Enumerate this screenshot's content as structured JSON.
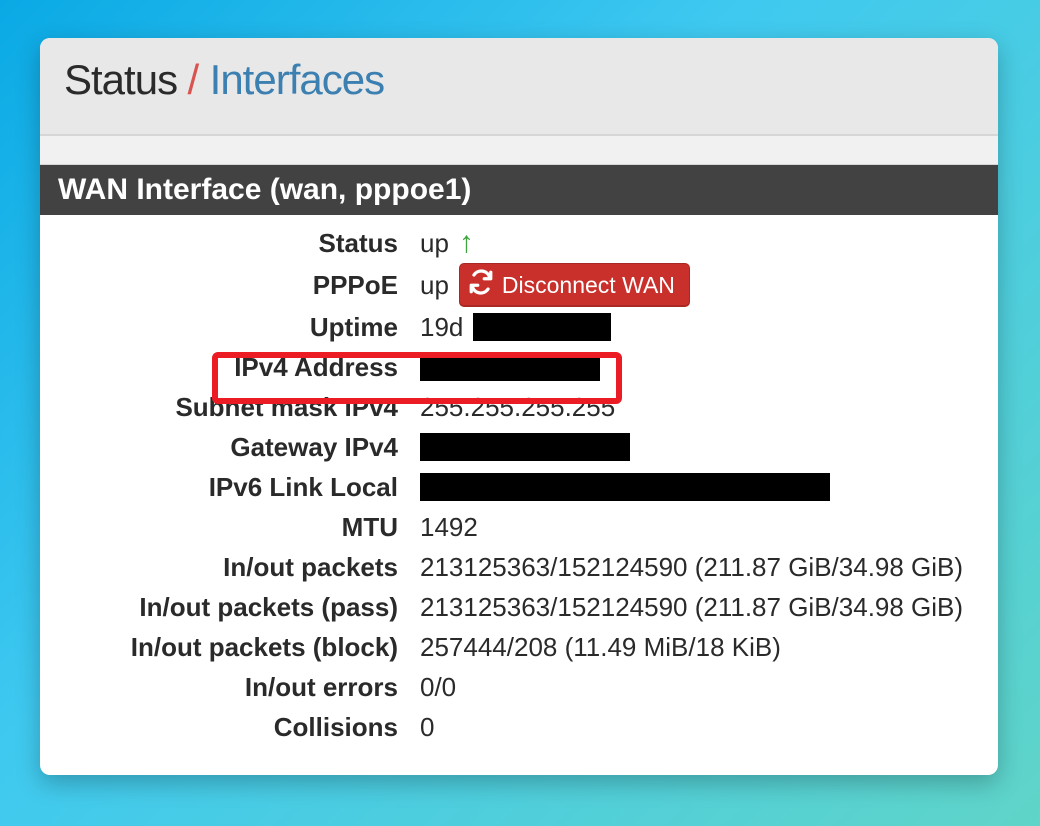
{
  "breadcrumb": {
    "parent": "Status",
    "separator": "/",
    "current": "Interfaces"
  },
  "section": {
    "title": "WAN Interface (wan, pppoe1)"
  },
  "rows": {
    "status": {
      "label": "Status",
      "value": "up"
    },
    "pppoe": {
      "label": "PPPoE",
      "value": "up"
    },
    "uptime": {
      "label": "Uptime",
      "value": "19d"
    },
    "ipv4": {
      "label": "IPv4 Address"
    },
    "subnet": {
      "label": "Subnet mask IPv4",
      "value": "255.255.255.255"
    },
    "gateway": {
      "label": "Gateway IPv4"
    },
    "ipv6ll": {
      "label": "IPv6 Link Local"
    },
    "mtu": {
      "label": "MTU",
      "value": "1492"
    },
    "pkts": {
      "label": "In/out packets",
      "value": "213125363/152124590 (211.87 GiB/34.98 GiB)"
    },
    "pkts_pass": {
      "label": "In/out packets (pass)",
      "value": "213125363/152124590 (211.87 GiB/34.98 GiB)"
    },
    "pkts_block": {
      "label": "In/out packets (block)",
      "value": "257444/208 (11.49 MiB/18 KiB)"
    },
    "errors": {
      "label": "In/out errors",
      "value": "0/0"
    },
    "collisions": {
      "label": "Collisions",
      "value": "0"
    }
  },
  "buttons": {
    "disconnect_wan": "Disconnect WAN"
  },
  "icons": {
    "status_arrow": "↑"
  }
}
